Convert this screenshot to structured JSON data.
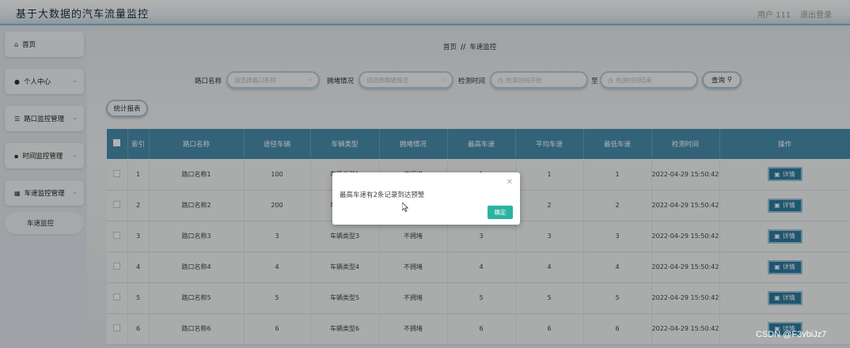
{
  "header": {
    "title": "基于大数据的汽车流量监控",
    "user": "用户 111",
    "logout": "退出登录"
  },
  "sidebar": {
    "items": [
      {
        "label": "首页",
        "icon": "home-icon"
      },
      {
        "label": "个人中心",
        "icon": "user-icon"
      },
      {
        "label": "路口监控管理",
        "icon": "list-icon"
      },
      {
        "label": "时间监控管理",
        "icon": "comment-icon"
      },
      {
        "label": "车速监控管理",
        "icon": "grid-icon"
      }
    ],
    "sub_item": "车速监控"
  },
  "breadcrumb": {
    "home": "首页",
    "sep": "//",
    "current": "车速监控"
  },
  "filters": {
    "road_label": "路口名称",
    "road_placeholder": "请选择路口名称",
    "jam_label": "拥堵情况",
    "jam_placeholder": "请选择拥堵情况",
    "time_label": "检测时间",
    "start_placeholder": "检测时间开始",
    "to_label": "至",
    "end_placeholder": "检测时间结束",
    "search_label": "查询"
  },
  "report_button": "统计报表",
  "table": {
    "headers": [
      "",
      "索引",
      "路口名称",
      "途径车辆",
      "车辆类型",
      "拥堵情况",
      "最高车速",
      "平均车速",
      "最低车速",
      "检测时间",
      "操作"
    ],
    "detail_label": "详情",
    "rows": [
      {
        "idx": "1",
        "name": "路口名称1",
        "count": "100",
        "type": "车辆类型1",
        "jam": "不拥堵",
        "max": "1",
        "avg": "1",
        "min": "1",
        "time": "2022-04-29 15:50:42"
      },
      {
        "idx": "2",
        "name": "路口名称2",
        "count": "200",
        "type": "车辆类型2",
        "jam": "不拥堵",
        "max": "2",
        "avg": "2",
        "min": "2",
        "time": "2022-04-29 15:50:42"
      },
      {
        "idx": "3",
        "name": "路口名称3",
        "count": "3",
        "type": "车辆类型3",
        "jam": "不拥堵",
        "max": "3",
        "avg": "3",
        "min": "3",
        "time": "2022-04-29 15:50:42"
      },
      {
        "idx": "4",
        "name": "路口名称4",
        "count": "4",
        "type": "车辆类型4",
        "jam": "不拥堵",
        "max": "4",
        "avg": "4",
        "min": "4",
        "time": "2022-04-29 15:50:42"
      },
      {
        "idx": "5",
        "name": "路口名称5",
        "count": "5",
        "type": "车辆类型5",
        "jam": "不拥堵",
        "max": "5",
        "avg": "5",
        "min": "5",
        "time": "2022-04-29 15:50:42"
      },
      {
        "idx": "6",
        "name": "路口名称6",
        "count": "6",
        "type": "车辆类型6",
        "jam": "不拥堵",
        "max": "6",
        "avg": "6",
        "min": "6",
        "time": "2022-04-29 15:50:42"
      }
    ]
  },
  "modal": {
    "message": "最高车速有2条记录到达预警",
    "ok_label": "确定"
  },
  "watermark": "CSDN @F3vbiJz7",
  "colors": {
    "table_header": "#4a8fae",
    "detail_button": "#2c7ba1",
    "modal_ok": "#2ab3a0"
  }
}
